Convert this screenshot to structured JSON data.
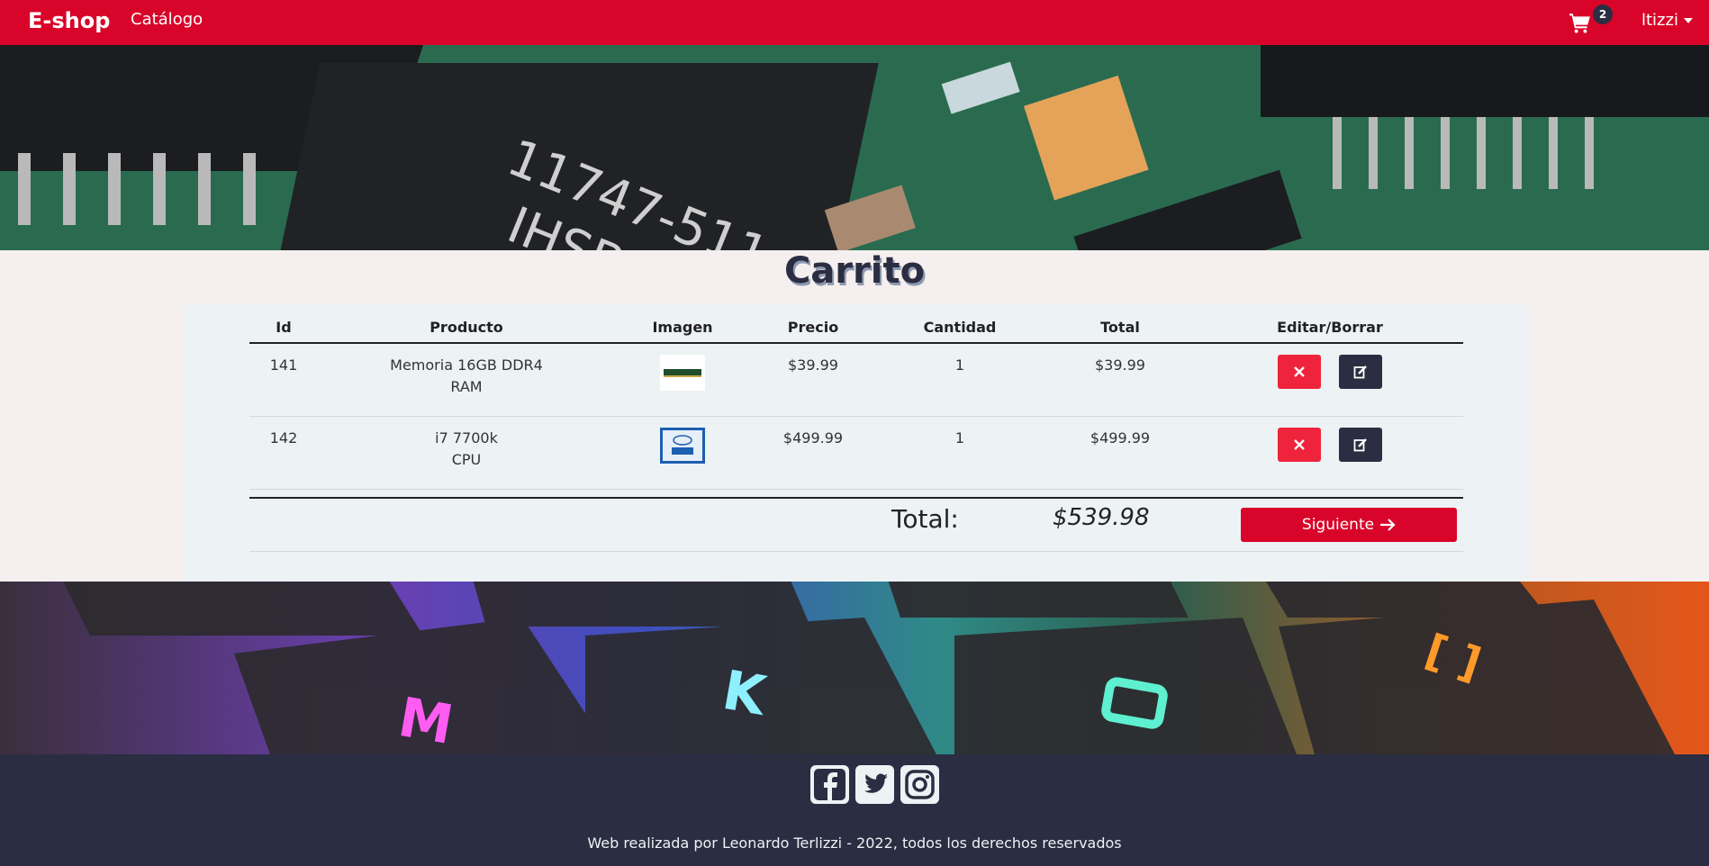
{
  "navbar": {
    "brand": "E-shop",
    "catalog_link": "Catálogo",
    "cart_count": "2",
    "user_name": "ltizzi",
    "cart_icon": "cart-icon"
  },
  "cart": {
    "title": "Carrito",
    "columns": [
      "Id",
      "Producto",
      "Imagen",
      "Precio",
      "Cantidad",
      "Total",
      "Editar/Borrar"
    ],
    "items": [
      {
        "id": "141",
        "product_line1": "Memoria 16GB DDR4",
        "product_line2": "RAM",
        "image": "ram-module-image",
        "price": "$39.99",
        "quantity": "1",
        "total": "$39.99"
      },
      {
        "id": "142",
        "product_line1": "i7 7700k",
        "product_line2": "CPU",
        "image": "intel-cpu-image",
        "price": "$499.99",
        "quantity": "1",
        "total": "$499.99"
      }
    ],
    "total_label": "Total:",
    "total_value": "$539.98",
    "next_button": "Siguiente",
    "next_icon": "arrow-right-icon",
    "delete_icon": "close-icon",
    "edit_icon": "edit-icon"
  },
  "footer": {
    "social_icons": [
      "facebook-icon",
      "twitter-icon",
      "instagram-icon"
    ],
    "copyright": "Web realizada por Leonardo Terlizzi - 2022, todos los derechos reservados"
  },
  "colors": {
    "primary": "#d90429",
    "danger": "#ef233c",
    "dark": "#2b2d42",
    "light": "#edf2f4",
    "background": "#f5efef"
  }
}
